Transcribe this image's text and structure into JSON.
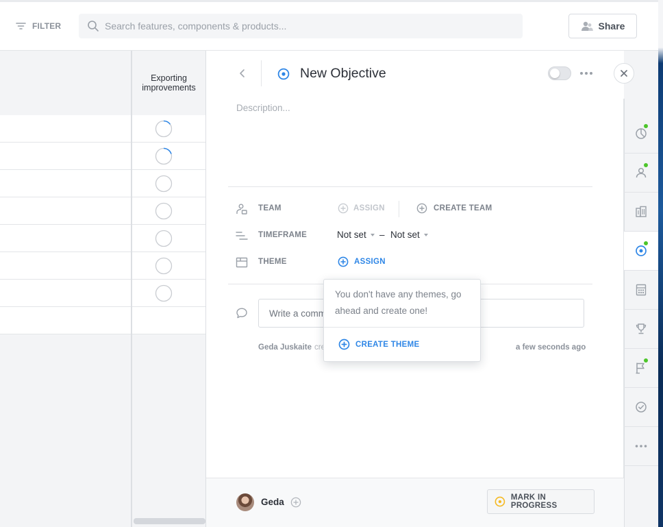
{
  "header": {
    "filter_label": "FILTER",
    "search_placeholder": "Search features, components & products...",
    "share_label": "Share"
  },
  "table": {
    "column_header": "Exporting improvements",
    "rows": [
      {
        "progress": 0.15
      },
      {
        "progress": 0.2
      },
      {
        "progress": 0
      },
      {
        "progress": 0
      },
      {
        "progress": 0
      },
      {
        "progress": 0
      },
      {
        "progress": 0
      }
    ]
  },
  "objective": {
    "title": "New Objective",
    "description_placeholder": "Description...",
    "fields": {
      "team_label": "TEAM",
      "team_assign": "ASSIGN",
      "create_team": "CREATE TEAM",
      "timeframe_label": "TIMEFRAME",
      "timeframe_start": "Not set",
      "timeframe_separator": "–",
      "timeframe_end": "Not set",
      "theme_label": "THEME",
      "theme_assign": "ASSIGN"
    },
    "comment_placeholder": "Write a comment...",
    "activity": {
      "user": "Geda Juskaite",
      "verb": "cre",
      "time": "a few seconds ago"
    }
  },
  "popover": {
    "message": "You don't have any themes, go ahead and create one!",
    "create_label": "CREATE THEME"
  },
  "footer": {
    "owner_name": "Geda",
    "mark_label": "MARK IN PROGRESS"
  },
  "colors": {
    "accent": "#2e86e6",
    "status_dot": "#4cc52a",
    "in_progress": "#f5b921"
  },
  "sidebar": {
    "items": [
      {
        "icon": "chart-pie-icon",
        "badge": true
      },
      {
        "icon": "user-icon",
        "badge": true
      },
      {
        "icon": "building-icon",
        "badge": false
      },
      {
        "icon": "objective-target-icon",
        "badge": true,
        "active": true
      },
      {
        "icon": "calculator-icon",
        "badge": false
      },
      {
        "icon": "trophy-icon",
        "badge": false
      },
      {
        "icon": "flag-icon",
        "badge": true
      },
      {
        "icon": "check-circle-icon",
        "badge": false
      },
      {
        "icon": "more-icon",
        "badge": false
      }
    ]
  }
}
